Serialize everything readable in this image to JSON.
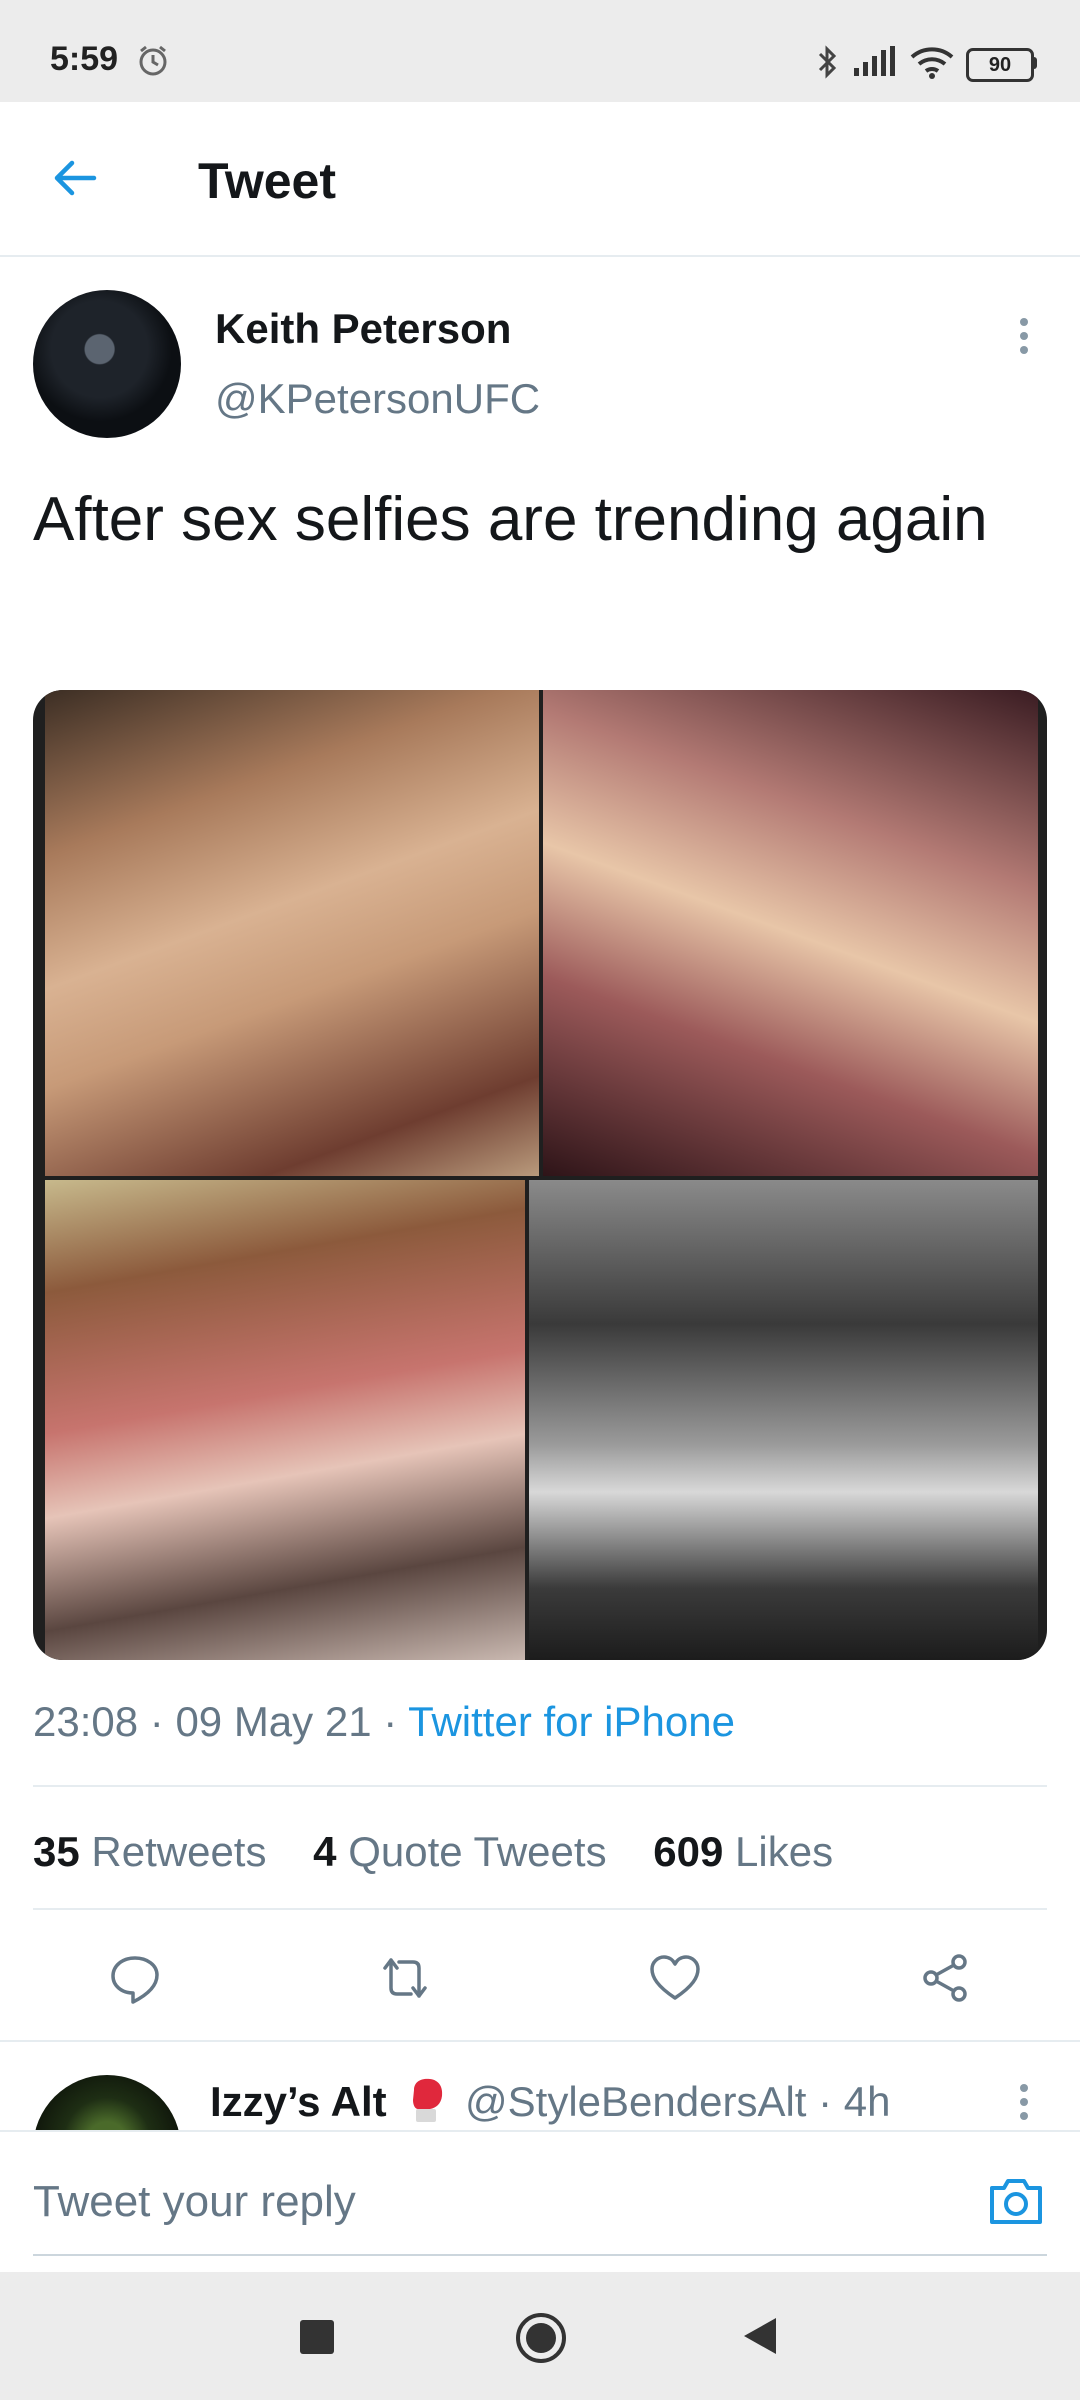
{
  "status_bar": {
    "time": "5:59",
    "battery": "90"
  },
  "header": {
    "title": "Tweet"
  },
  "tweet": {
    "author_name": "Keith Peterson",
    "author_handle": "@KPetersonUFC",
    "text": "After sex selfies are trending again",
    "time": "23:08",
    "date": "09 May 21",
    "source": "Twitter for iPhone",
    "retweets_count": "35",
    "retweets_label": "Retweets",
    "quotes_count": "4",
    "quotes_label": "Quote Tweets",
    "likes_count": "609",
    "likes_label": "Likes"
  },
  "reply_preview": {
    "name": "Izzy’s Alt",
    "handle": "@StyleBendersAlt",
    "age": "4h"
  },
  "reply_bar": {
    "placeholder": "Tweet your reply"
  },
  "colors": {
    "accent": "#1b95e0",
    "secondary_text": "#657786",
    "divider": "#e6ecf0"
  },
  "icons": [
    "alarm-icon",
    "bluetooth-icon",
    "signal-icon",
    "wifi-icon",
    "back-arrow-icon",
    "more-vertical-icon",
    "reply-icon",
    "retweet-icon",
    "like-icon",
    "share-icon",
    "boxing-glove-icon",
    "camera-icon",
    "nav-recents-icon",
    "nav-home-icon",
    "nav-back-icon"
  ]
}
